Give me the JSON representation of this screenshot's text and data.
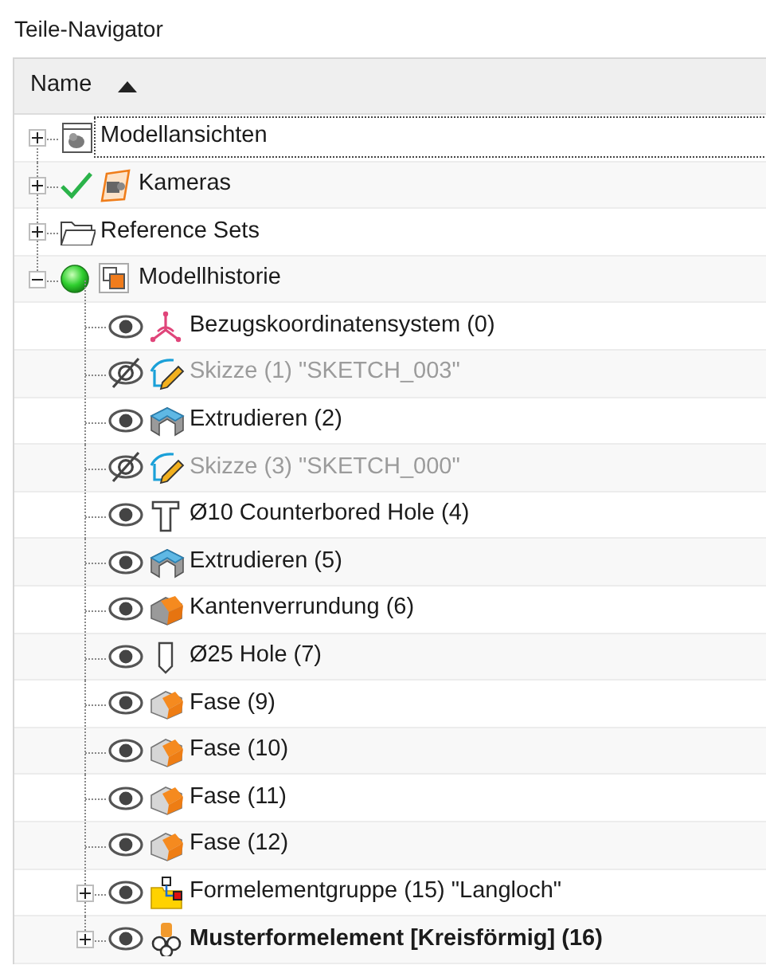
{
  "panel": {
    "title": "Teile-Navigator"
  },
  "columns": [
    {
      "label": "Name",
      "ascending": true
    }
  ],
  "tree": [
    {
      "label": "Modellansichten",
      "kind": "views",
      "expanded": false,
      "focused": true
    },
    {
      "label": "Kameras",
      "kind": "camera",
      "checked": true,
      "expanded": false
    },
    {
      "label": "Reference Sets",
      "kind": "folder",
      "expanded": false
    },
    {
      "label": "Modellhistorie",
      "kind": "history",
      "active": true,
      "expanded": true,
      "children": [
        {
          "label": "Bezugskoordinatensystem (0)",
          "kind": "datum",
          "visible": true
        },
        {
          "label": "Skizze (1) \"SKETCH_003\"",
          "kind": "sketch",
          "visible": false
        },
        {
          "label": "Extrudieren (2)",
          "kind": "extrude",
          "visible": true
        },
        {
          "label": "Skizze (3) \"SKETCH_000\"",
          "kind": "sketch",
          "visible": false
        },
        {
          "label": "Ø10 Counterbored Hole (4)",
          "kind": "counterbore",
          "visible": true
        },
        {
          "label": "Extrudieren (5)",
          "kind": "extrude",
          "visible": true
        },
        {
          "label": "Kantenverrundung (6)",
          "kind": "blend",
          "visible": true
        },
        {
          "label": "Ø25 Hole (7)",
          "kind": "hole",
          "visible": true
        },
        {
          "label": "Fase (9)",
          "kind": "chamfer",
          "visible": true
        },
        {
          "label": "Fase (10)",
          "kind": "chamfer",
          "visible": true
        },
        {
          "label": "Fase (11)",
          "kind": "chamfer",
          "visible": true
        },
        {
          "label": "Fase (12)",
          "kind": "chamfer",
          "visible": true
        },
        {
          "label": "Formelementgruppe (15) \"Langloch\"",
          "kind": "group",
          "visible": true,
          "expanded": false
        },
        {
          "label": "Musterformelement [Kreisförmig] (16)",
          "kind": "pattern",
          "visible": true,
          "expanded": false,
          "current": true
        }
      ]
    }
  ]
}
